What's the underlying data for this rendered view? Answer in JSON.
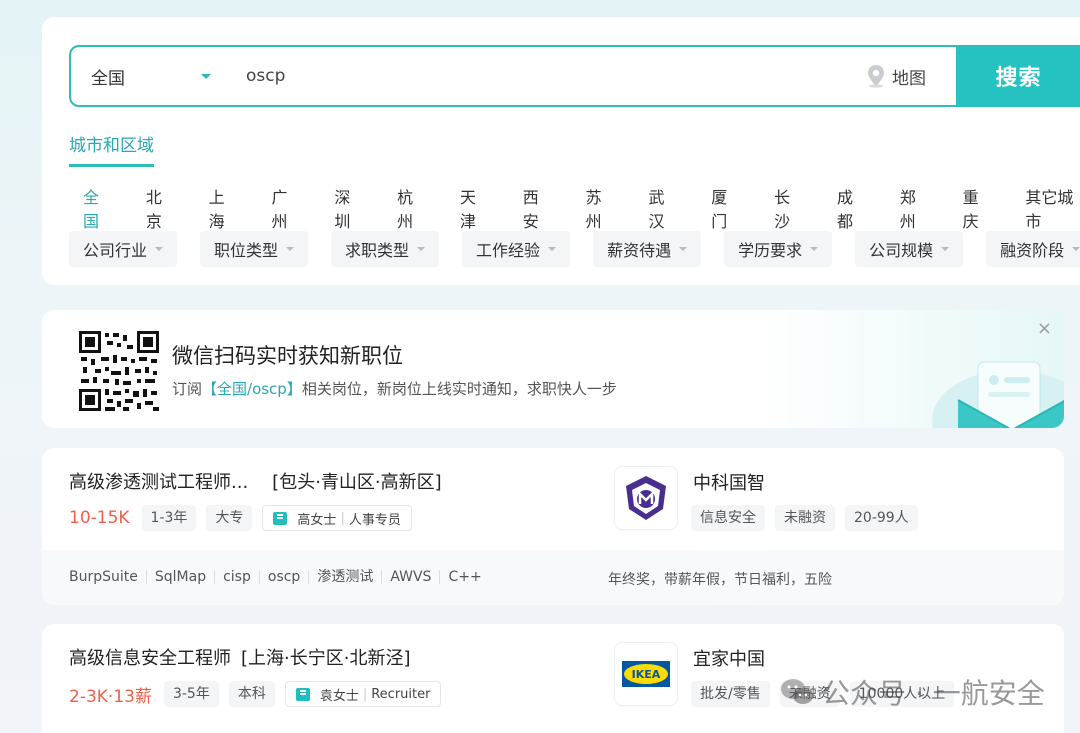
{
  "search": {
    "city": "全国",
    "query": "oscp",
    "map_label": "地图",
    "button_label": "搜索"
  },
  "region_tab": "城市和区域",
  "cities": [
    "全国",
    "北京",
    "上海",
    "广州",
    "深圳",
    "杭州",
    "天津",
    "西安",
    "苏州",
    "武汉",
    "厦门",
    "长沙",
    "成都",
    "郑州",
    "重庆",
    "其它城市"
  ],
  "filters": [
    "公司行业",
    "职位类型",
    "求职类型",
    "工作经验",
    "薪资待遇",
    "学历要求",
    "公司规模",
    "融资阶段"
  ],
  "subscription": {
    "title": "微信扫码实时获知新职位",
    "desc_prefix": "订阅",
    "desc_highlight": "【全国/oscp】",
    "desc_suffix": "相关岗位，新岗位上线实时通知，求职快人一步",
    "close": "×"
  },
  "jobs": [
    {
      "title": "高级渗透测试工程师...",
      "location": "[包头·青山区·高新区]",
      "salary": "10-15K",
      "experience": "1-3年",
      "education": "大专",
      "hr_name": "高女士",
      "hr_role": "人事专员",
      "company": "中科国智",
      "company_tags": [
        "信息安全",
        "未融资",
        "20-99人"
      ],
      "skills": [
        "BurpSuite",
        "SqlMap",
        "cisp",
        "oscp",
        "渗透测试",
        "AWVS",
        "C++"
      ],
      "benefits": "年终奖，带薪年假，节日福利，五险"
    },
    {
      "title": "高级信息安全工程师",
      "location": "[上海·长宁区·北新泾]",
      "salary": "2-3K·13薪",
      "experience": "3-5年",
      "education": "本科",
      "hr_name": "袁女士",
      "hr_role": "Recruiter",
      "company": "宜家中国",
      "company_logo_text": "IKEA",
      "company_tags": [
        "批发/零售",
        "未融资",
        "10000人以上"
      ]
    }
  ],
  "watermark": "公众号 · 一航安全",
  "colors": {
    "accent": "#25c2c2",
    "salary": "#f2604a"
  }
}
